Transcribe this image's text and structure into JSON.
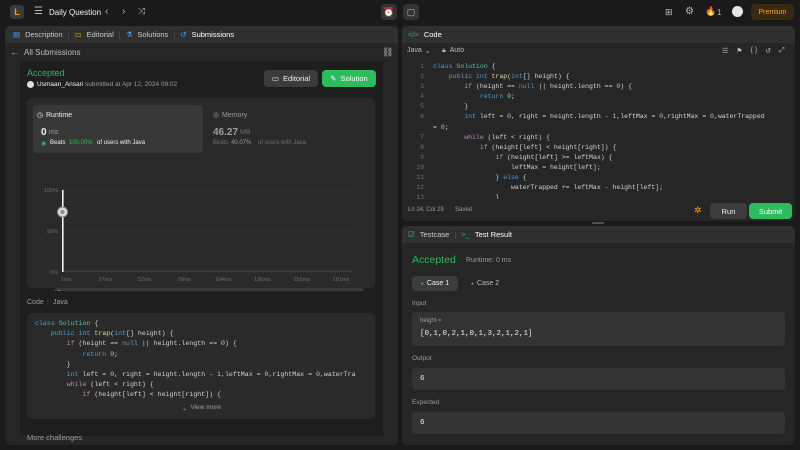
{
  "header": {
    "title": "Daily Question",
    "streak": "1",
    "premium": "Premium"
  },
  "left_tabs": [
    "Description",
    "Editorial",
    "Solutions",
    "Submissions"
  ],
  "back_label": "All Submissions",
  "submission": {
    "status": "Accepted",
    "user": "Usmaan_Ansari",
    "submitted": "submitted at Apr 12, 2024 09:02",
    "editorial_btn": "Editorial",
    "solution_btn": "Solution"
  },
  "runtime": {
    "label": "Runtime",
    "value": "0",
    "unit": "ms",
    "beats_prefix": "Beats",
    "beats_pct": "100.00%",
    "beats_suffix": "of users with Java"
  },
  "memory": {
    "label": "Memory",
    "value": "46.27",
    "unit": "MB",
    "beats_prefix": "Beats",
    "beats_pct": "40.07%",
    "beats_suffix": "of users with Java"
  },
  "chart_data": {
    "type": "bar",
    "y_ticks": [
      "100%",
      "50%",
      "0%"
    ],
    "x_ticks": [
      "1ms",
      "27ms",
      "52ms",
      "78ms",
      "104ms",
      "130ms",
      "155ms",
      "181ms"
    ],
    "values": [
      100,
      2,
      1,
      1,
      1,
      1,
      1,
      1,
      1,
      1,
      1,
      1,
      1,
      1,
      1,
      1,
      1,
      1,
      1,
      1,
      1,
      1,
      1,
      1,
      1,
      1,
      1,
      1,
      1,
      1,
      1,
      1,
      1,
      1,
      1,
      1,
      1,
      1,
      1,
      1,
      1,
      1,
      1,
      1,
      1,
      1,
      1,
      1,
      1,
      1,
      1,
      1,
      1,
      1,
      1,
      1,
      1,
      1,
      1,
      1,
      1,
      1,
      1,
      1,
      1,
      1,
      1,
      1,
      1,
      1,
      1,
      1,
      1,
      1,
      1,
      1,
      1,
      1,
      1,
      1,
      1,
      1,
      1,
      1,
      1,
      1,
      1,
      1,
      1,
      1,
      1,
      1,
      1,
      1,
      1,
      1,
      1,
      1,
      1,
      1
    ]
  },
  "code_section": {
    "code_label": "Code",
    "lang": "Java",
    "view_more": "View more",
    "more_challenges": "More challenges"
  },
  "left_code": [
    "class Solution {",
    "    public int trap(int[] height) {",
    "        if (height == null || height.length == 0) {",
    "            return 0;",
    "        }",
    "        int left = 0, right = height.length - 1,leftMax = 0,rightMax = 0,waterTra",
    "        while (left < right) {",
    "            if (height[left] < height[right]) {"
  ],
  "editor": {
    "title": "Code",
    "lang": "Java",
    "auto": "Auto",
    "status": "Ln 24, Col 29",
    "saved": "Saved",
    "run": "Run",
    "submit": "Submit"
  },
  "editor_lines": [
    {
      "n": "1",
      "t": "class Solution {"
    },
    {
      "n": "2",
      "t": "    public int trap(int[] height) {"
    },
    {
      "n": "3",
      "t": "        if (height == null || height.length == 0) {"
    },
    {
      "n": "4",
      "t": "            return 0;"
    },
    {
      "n": "5",
      "t": "        }"
    },
    {
      "n": "6",
      "t": "        int left = 0, right = height.length - 1,leftMax = 0,rightMax = 0,waterTrapped"
    },
    {
      "n": "",
      "t": "= 0;"
    },
    {
      "n": "7",
      "t": "        while (left < right) {"
    },
    {
      "n": "8",
      "t": "            if (height[left] < height[right]) {"
    },
    {
      "n": "9",
      "t": "                if (height[left] >= leftMax) {"
    },
    {
      "n": "10",
      "t": "                    leftMax = height[left];"
    },
    {
      "n": "11",
      "t": "                } else {"
    },
    {
      "n": "12",
      "t": "                    waterTrapped += leftMax - height[left];"
    },
    {
      "n": "13",
      "t": "                }"
    }
  ],
  "result": {
    "tab1": "Testcase",
    "tab2": "Test Result",
    "status": "Accepted",
    "runtime": "Runtime: 0 ms",
    "case1": "Case 1",
    "case2": "Case 2",
    "input_label": "Input",
    "var": "height =",
    "input_value": "[0,1,0,2,1,0,1,3,2,1,2,1]",
    "output_label": "Output",
    "output_value": "6",
    "expected_label": "Expected",
    "expected_value": "6"
  }
}
